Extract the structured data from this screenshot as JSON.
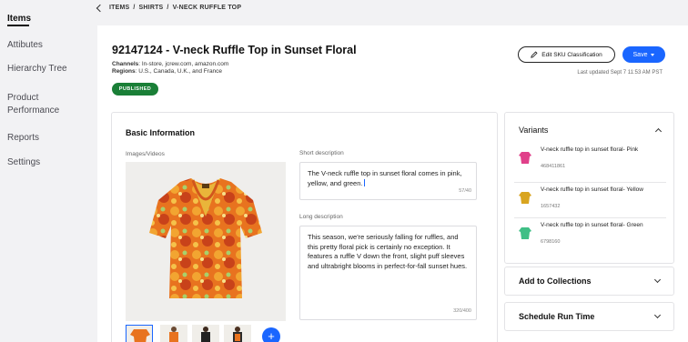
{
  "sidebar": {
    "items": [
      {
        "label": "Items"
      },
      {
        "label": "Attibutes"
      },
      {
        "label": "Hierarchy Tree"
      },
      {
        "label": "Product"
      },
      {
        "label": "Performance"
      },
      {
        "label": "Reports"
      },
      {
        "label": "Settings"
      }
    ]
  },
  "breadcrumb": {
    "items": [
      "ITEMS",
      "/",
      "SHIRTS",
      "/",
      "V-NECK RUFFLE TOP"
    ]
  },
  "product": {
    "title": "92147124 - V-neck Ruffle Top in Sunset Floral",
    "channels_label": "Channels",
    "channels_value": ": In-store, jcrew.com, amazon.com",
    "regions_label": "Regions",
    "regions_value": ": U.S., Canada, U.K., and France",
    "status": "PUBLISHED"
  },
  "actions": {
    "edit_label": "Edit SKU Classification",
    "save_label": "Save",
    "last_updated": "Last updated Sept 7 11:53 AM PST"
  },
  "basic_info": {
    "title": "Basic Information",
    "images_label": "Images/Videos",
    "short_label": "Short description",
    "short_text": "The V-neck ruffle top in sunset floral comes in pink, yellow, and green.",
    "short_counter": "57/40",
    "long_label": "Long description",
    "long_text": "This season, we're seriously falling for ruffles, and this pretty floral pick is certainly no exception. It features a ruffle V down the front, slight puff sleeves and ultrabright blooms in perfect-for-fall sunset hues.",
    "long_counter": "320/400",
    "add_symbol": "+"
  },
  "variants": {
    "title": "Variants",
    "items": [
      {
        "name": "V-neck ruffle top in sunset floral- Pink",
        "code": "468411861",
        "color": "#e0408a"
      },
      {
        "name": "V-neck ruffle top in sunset floral- Yellow",
        "code": "1657432",
        "color": "#d9a520"
      },
      {
        "name": "V-neck ruffle top in sunset floral- Green",
        "code": "6798160",
        "color": "#3fbf86"
      }
    ]
  },
  "accordions": {
    "collections": "Add to Collections",
    "schedule": "Schedule Run Time"
  }
}
